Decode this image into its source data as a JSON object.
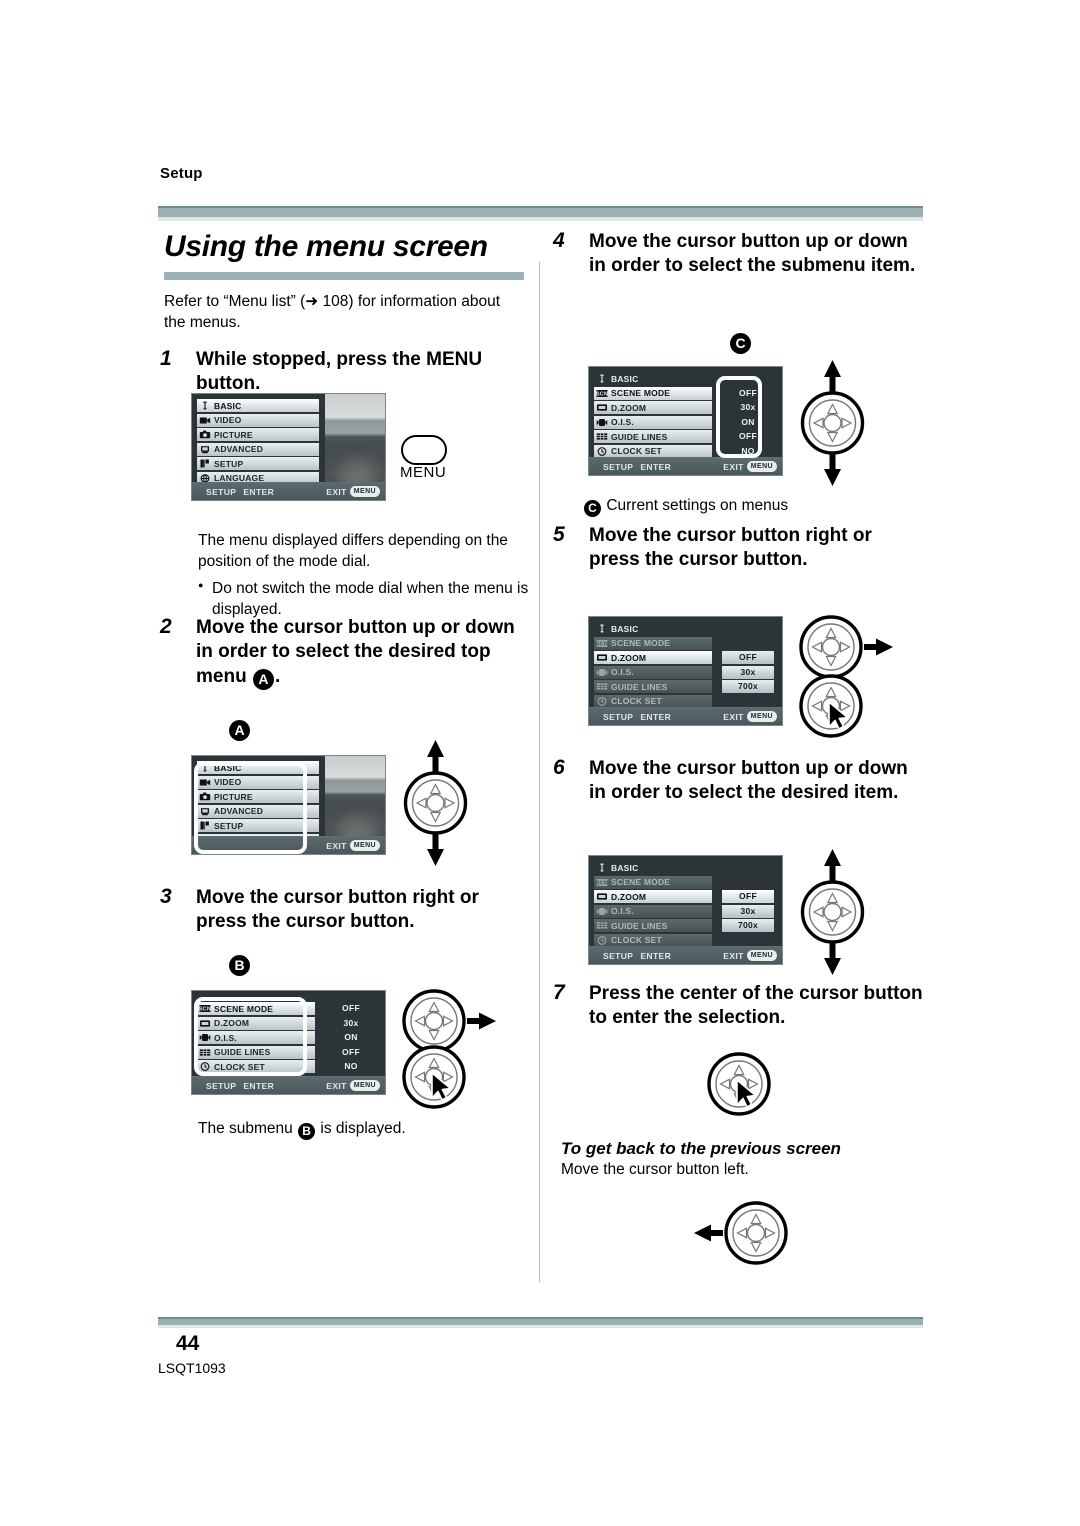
{
  "header": {
    "section_label": "Setup"
  },
  "title": "Using the menu screen",
  "intro": "Refer to “Menu list” (➜ 108) for information about the menus.",
  "steps": {
    "s1": {
      "num": "1",
      "text": "While stopped, press the MENU button."
    },
    "s2": {
      "num": "2",
      "text_a": "Move the cursor button up or down in order to select the desired top menu ",
      "badge": "A",
      "text_b": "."
    },
    "s3": {
      "num": "3",
      "text": "Move the cursor button right or press the cursor button."
    },
    "s4": {
      "num": "4",
      "text": "Move the cursor button up or down in order to select the submenu item."
    },
    "s5": {
      "num": "5",
      "text": "Move the cursor button right or press the cursor button."
    },
    "s6": {
      "num": "6",
      "text": "Move the cursor button up or down in order to select the desired item."
    },
    "s7": {
      "num": "7",
      "text": "Press the center of the cursor button to enter the selection."
    }
  },
  "notes": {
    "mode_dial": "The menu displayed differs depending on the position of the mode dial.",
    "mode_dial_bullet": "Do not switch the mode dial when the menu is displayed.",
    "submenu_pre": "The submenu ",
    "submenu_badge": "B",
    "submenu_post": " is displayed.",
    "current_settings_badge": "C",
    "current_settings": "Current settings on menus"
  },
  "back_section": {
    "heading": "To get back to the previous screen",
    "body": "Move the cursor button left."
  },
  "hardware": {
    "menu_button_label": "MENU"
  },
  "lcd": {
    "top_menu": {
      "items": [
        "BASIC",
        "VIDEO",
        "PICTURE",
        "ADVANCED",
        "SETUP",
        "LANGUAGE"
      ],
      "icons": [
        "basic-icon",
        "video-icon",
        "picture-icon",
        "advanced-icon",
        "setup-icon",
        "language-icon"
      ],
      "selected": "BASIC"
    },
    "submenu": {
      "header": "BASIC",
      "items": [
        "SCENE MODE",
        "D.ZOOM",
        "O.I.S.",
        "GUIDE LINES",
        "CLOCK SET"
      ],
      "icons": [
        "scene-mode-icon",
        "dzoom-icon",
        "ois-icon",
        "guide-lines-icon",
        "clock-set-icon"
      ],
      "values": [
        "OFF",
        "30x",
        "ON",
        "OFF",
        "NO"
      ],
      "selected": "SCENE MODE"
    },
    "dzoom_options": {
      "label": "D.ZOOM",
      "options": [
        "OFF",
        "30x",
        "700x"
      ],
      "selected": "OFF"
    },
    "status_bar": {
      "setup": "SETUP",
      "enter": "ENTER",
      "exit": "EXIT",
      "menu_pill": "MENU"
    }
  },
  "footer": {
    "page_number": "44",
    "doc_code": "LSQT1093"
  },
  "colors": {
    "rule": "#9bb0b2",
    "rule_top": "#6f8b8e",
    "lcd_bg": "#2b3436",
    "lcd_row": "#d3dadc"
  }
}
